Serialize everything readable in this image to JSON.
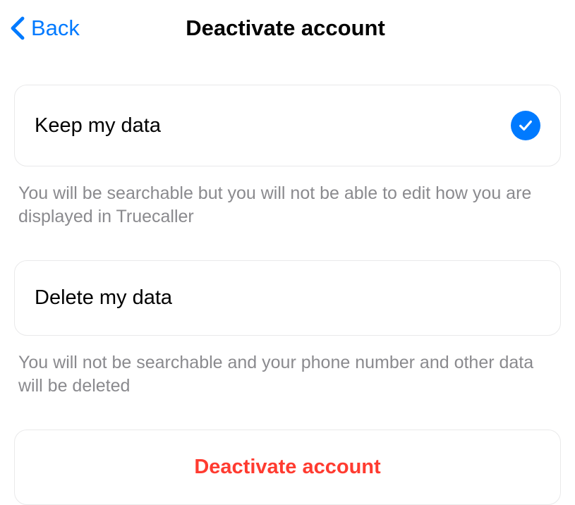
{
  "header": {
    "back_label": "Back",
    "title": "Deactivate account"
  },
  "options": {
    "keep": {
      "label": "Keep my data",
      "description": "You will be searchable but you will not be able to edit how you are displayed in Truecaller",
      "selected": true
    },
    "delete": {
      "label": "Delete my data",
      "description": "You will not be searchable and your phone number and other data will be deleted",
      "selected": false
    }
  },
  "action": {
    "deactivate_label": "Deactivate account"
  },
  "colors": {
    "accent": "#007aff",
    "destructive": "#ff3b30",
    "border": "#e9e9ea",
    "secondary_text": "#8a8a8e"
  }
}
